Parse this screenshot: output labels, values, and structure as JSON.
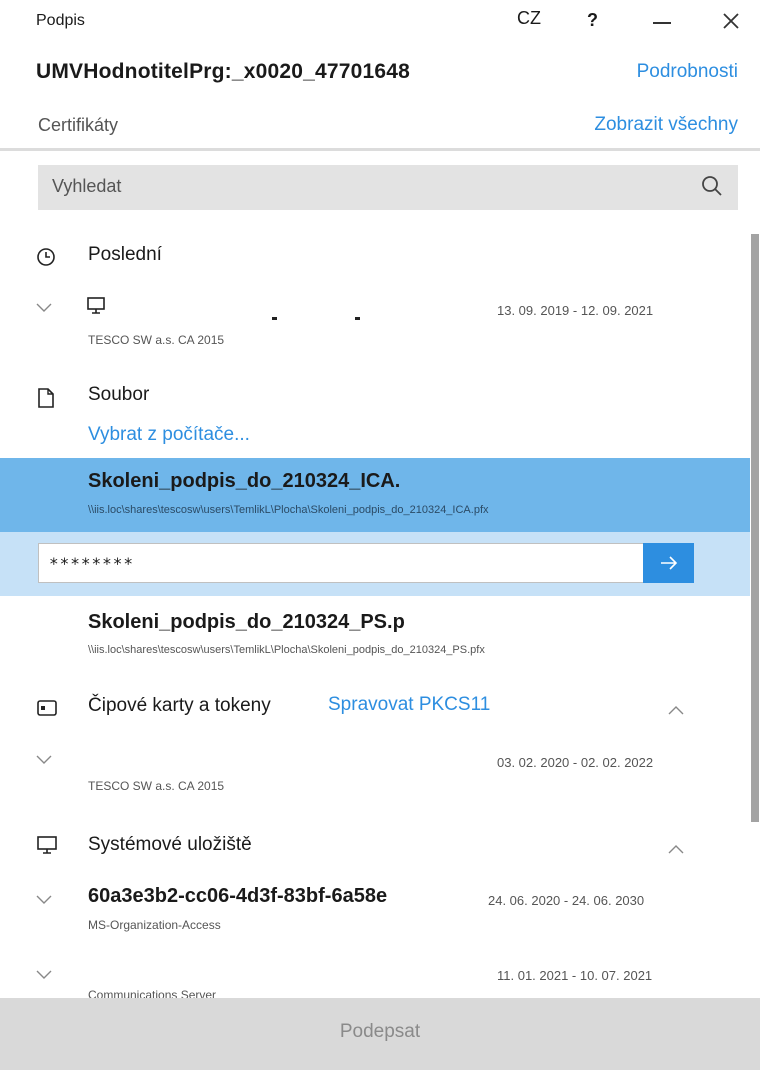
{
  "titlebar": {
    "title": "Podpis",
    "lang": "CZ",
    "help": "?"
  },
  "document": {
    "name": "UMVHodnotitelPrg:_x0020_47701648",
    "details_link": "Podrobnosti"
  },
  "certificates": {
    "label": "Certifikáty",
    "show_all": "Zobrazit všechny"
  },
  "search": {
    "placeholder": "Vyhledat"
  },
  "recent": {
    "title": "Poslední",
    "items": [
      {
        "issuer": "TESCO SW a.s. CA 2015",
        "validity": "13. 09. 2019 - 12. 09. 2021"
      }
    ]
  },
  "file": {
    "title": "Soubor",
    "choose_link": "Vybrat z počítače...",
    "items": [
      {
        "name": "Skoleni_podpis_do_210324_ICA.",
        "path": "\\\\iis.loc\\shares\\tescosw\\users\\TemlikL\\Plocha\\Skoleni_podpis_do_210324_ICA.pfx",
        "selected": true
      },
      {
        "name": "Skoleni_podpis_do_210324_PS.p",
        "path": "\\\\iis.loc\\shares\\tescosw\\users\\TemlikL\\Plocha\\Skoleni_podpis_do_210324_PS.pfx",
        "selected": false
      }
    ],
    "password_value": "********"
  },
  "smartcards": {
    "title": "Čipové karty a tokeny",
    "manage_link": "Spravovat PKCS11",
    "items": [
      {
        "issuer": "TESCO SW a.s. CA 2015",
        "validity": "03. 02. 2020 - 02. 02. 2022"
      }
    ]
  },
  "system_store": {
    "title": "Systémové uložiště",
    "items": [
      {
        "name": "60a3e3b2-cc06-4d3f-83bf-6a58e",
        "issuer": "MS-Organization-Access",
        "validity": "24. 06. 2020 - 24. 06. 2030"
      },
      {
        "name": "",
        "issuer": "Communications Server",
        "validity": "11. 01. 2021 - 10. 07. 2021"
      }
    ]
  },
  "footer": {
    "sign_button": "Podepsat"
  },
  "colors": {
    "accent": "#2d8ee0",
    "selected_row": "#6fb6ea",
    "password_row": "#c6e1f7",
    "footer": "#d9d9d9"
  },
  "icons": [
    "clock-icon",
    "monitor-icon",
    "file-icon",
    "smartcard-icon",
    "chevron-down-icon",
    "chevron-up-icon",
    "search-icon",
    "arrow-right-icon",
    "close-icon",
    "minimize-icon"
  ]
}
